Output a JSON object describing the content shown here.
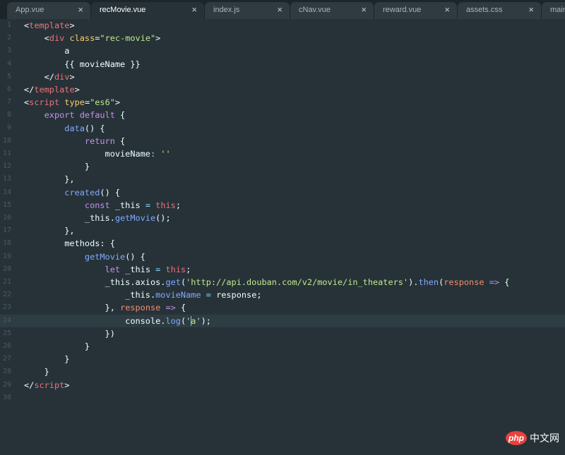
{
  "tabs": [
    {
      "label": "App.vue",
      "active": false
    },
    {
      "label": "recMovie.vue",
      "active": true
    },
    {
      "label": "index.js",
      "active": false
    },
    {
      "label": "cNav.vue",
      "active": false
    },
    {
      "label": "reward.vue",
      "active": false
    },
    {
      "label": "assets.css",
      "active": false
    },
    {
      "label": "main",
      "active": false
    }
  ],
  "tab_close_glyph": "×",
  "current_line": 24,
  "code_lines": [
    [
      [
        "<",
        ""
      ],
      [
        "template",
        "t-tag"
      ],
      [
        ">",
        ""
      ]
    ],
    [
      [
        "    <",
        ""
      ],
      [
        "div",
        "t-tag"
      ],
      [
        " ",
        ""
      ],
      [
        "class",
        "t-attr"
      ],
      [
        "=",
        ""
      ],
      [
        "\"rec-movie\"",
        "t-str"
      ],
      [
        ">",
        ""
      ]
    ],
    [
      [
        "        a",
        ""
      ]
    ],
    [
      [
        "        {{ movieName }}",
        ""
      ]
    ],
    [
      [
        "    </",
        ""
      ],
      [
        "div",
        "t-tag"
      ],
      [
        ">",
        ""
      ]
    ],
    [
      [
        "</",
        ""
      ],
      [
        "template",
        "t-tag"
      ],
      [
        ">",
        ""
      ]
    ],
    [
      [
        "<",
        ""
      ],
      [
        "script",
        "t-tag"
      ],
      [
        " ",
        ""
      ],
      [
        "type",
        "t-attr"
      ],
      [
        "=",
        ""
      ],
      [
        "\"es6\"",
        "t-str"
      ],
      [
        ">",
        ""
      ]
    ],
    [
      [
        "    ",
        ""
      ],
      [
        "export default",
        "t-kw"
      ],
      [
        " {",
        ""
      ]
    ],
    [
      [
        "        ",
        ""
      ],
      [
        "data",
        "t-fn"
      ],
      [
        "() {",
        ""
      ]
    ],
    [
      [
        "            ",
        ""
      ],
      [
        "return",
        "t-kw"
      ],
      [
        " {",
        ""
      ]
    ],
    [
      [
        "                movieName",
        ""
      ],
      [
        ":",
        "t-pun"
      ],
      [
        " ",
        ""
      ],
      [
        "''",
        "t-str"
      ]
    ],
    [
      [
        "            }",
        ""
      ]
    ],
    [
      [
        "        },",
        ""
      ]
    ],
    [
      [
        "        ",
        ""
      ],
      [
        "created",
        "t-fn"
      ],
      [
        "() {",
        ""
      ]
    ],
    [
      [
        "            ",
        ""
      ],
      [
        "const",
        "t-kw"
      ],
      [
        " _this ",
        ""
      ],
      [
        "=",
        "t-pun"
      ],
      [
        " ",
        ""
      ],
      [
        "this",
        "t-tag"
      ],
      [
        ";",
        ""
      ]
    ],
    [
      [
        "            _this.",
        ""
      ],
      [
        "getMovie",
        "t-fn"
      ],
      [
        "();",
        ""
      ]
    ],
    [
      [
        "        },",
        ""
      ]
    ],
    [
      [
        "        methods: {",
        ""
      ]
    ],
    [
      [
        "            ",
        ""
      ],
      [
        "getMovie",
        "t-fn"
      ],
      [
        "() {",
        ""
      ]
    ],
    [
      [
        "                ",
        ""
      ],
      [
        "let",
        "t-kw"
      ],
      [
        " _this ",
        ""
      ],
      [
        "=",
        "t-pun"
      ],
      [
        " ",
        ""
      ],
      [
        "this",
        "t-tag"
      ],
      [
        ";",
        ""
      ]
    ],
    [
      [
        "                _this.axios.",
        ""
      ],
      [
        "get",
        "t-fn"
      ],
      [
        "(",
        ""
      ],
      [
        "'http://api.douban.com/v2/movie/in_theaters'",
        "t-str"
      ],
      [
        ").",
        ""
      ],
      [
        "then",
        "t-fn"
      ],
      [
        "(",
        ""
      ],
      [
        "response",
        "t-param"
      ],
      [
        " ",
        ""
      ],
      [
        "=>",
        "t-kw"
      ],
      [
        " {",
        ""
      ]
    ],
    [
      [
        "                    _this.",
        ""
      ],
      [
        "movieName",
        "t-fn"
      ],
      [
        " ",
        ""
      ],
      [
        "=",
        "t-pun"
      ],
      [
        " response;",
        ""
      ]
    ],
    [
      [
        "                }, ",
        ""
      ],
      [
        "response",
        "t-param"
      ],
      [
        " ",
        ""
      ],
      [
        "=>",
        "t-kw"
      ],
      [
        " {",
        ""
      ]
    ],
    [
      [
        "                    console.",
        ""
      ],
      [
        "log",
        "t-fn"
      ],
      [
        "(",
        ""
      ],
      [
        "'",
        "t-str"
      ],
      [
        "|cursor|",
        ""
      ],
      [
        "a'",
        "t-str"
      ],
      [
        ");",
        ""
      ]
    ],
    [
      [
        "                })",
        ""
      ]
    ],
    [
      [
        "            }",
        ""
      ]
    ],
    [
      [
        "        }",
        ""
      ]
    ],
    [
      [
        "    }",
        ""
      ]
    ],
    [
      [
        "</",
        ""
      ],
      [
        "script",
        "t-tag"
      ],
      [
        ">",
        ""
      ]
    ],
    []
  ],
  "watermark": {
    "logo": "php",
    "text": "中文网"
  }
}
